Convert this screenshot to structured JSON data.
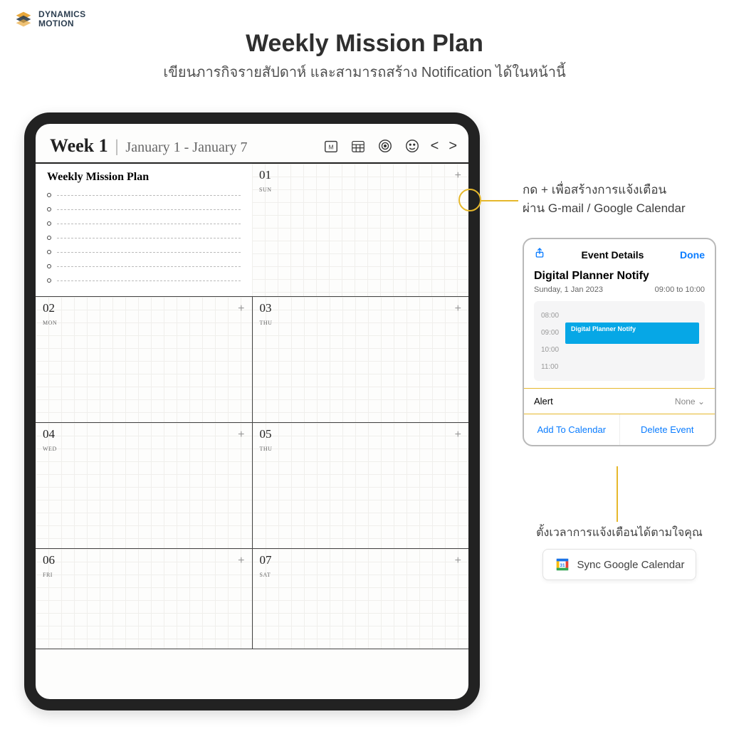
{
  "logo": {
    "line1": "DYNAMICS",
    "line2": "MOTION"
  },
  "hero": {
    "title": "Weekly Mission Plan",
    "subtitle": "เขียนภารกิจรายสัปดาห์ และสามารถสร้าง Notification ได้ในหน้านี้"
  },
  "planner": {
    "week_label": "Week 1",
    "date_range": "January 1 - January 7",
    "mission_heading": "Weekly Mission Plan",
    "days": [
      {
        "num": "01",
        "dow": "SUN"
      },
      {
        "num": "02",
        "dow": "MON"
      },
      {
        "num": "03",
        "dow": "THU"
      },
      {
        "num": "04",
        "dow": "WED"
      },
      {
        "num": "05",
        "dow": "THU"
      },
      {
        "num": "06",
        "dow": "FRI"
      },
      {
        "num": "07",
        "dow": "SAT"
      }
    ]
  },
  "callouts": {
    "plus_hint": "กด + เพื่อสร้างการแจ้งเตือน\nผ่าน G-mail / Google Calendar",
    "alert_hint": "ตั้งเวลาการแจ้งเตือนได้ตามใจคุณ",
    "sync_label": "Sync Google Calendar"
  },
  "event_panel": {
    "header_title": "Event Details",
    "done": "Done",
    "event_name": "Digital Planner Notify",
    "date_text": "Sunday, 1 Jan 2023",
    "time_text": "09:00 to 10:00",
    "hours": [
      "08:00",
      "09:00",
      "10:00",
      "11:00"
    ],
    "event_block_label": "Digital Planner Notify",
    "alert_label": "Alert",
    "alert_value": "None ⌄",
    "add_btn": "Add To Calendar",
    "delete_btn": "Delete Event"
  }
}
